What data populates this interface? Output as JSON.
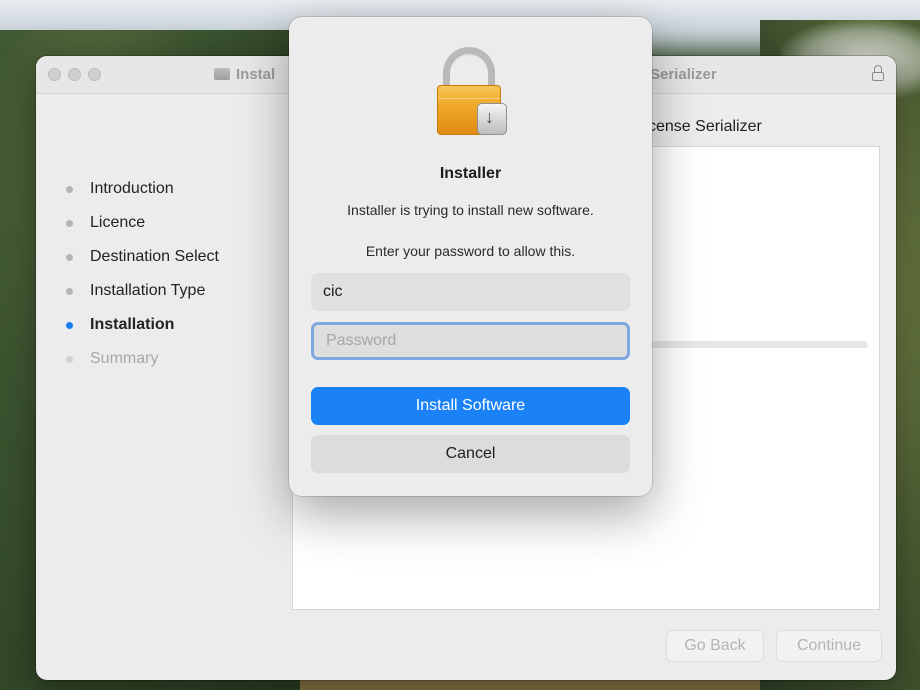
{
  "window": {
    "title_left": "Instal",
    "title_right": "Serializer",
    "subtitle": "cense Serializer"
  },
  "sidebar": {
    "items": [
      {
        "label": "Introduction",
        "state": "done"
      },
      {
        "label": "Licence",
        "state": "done"
      },
      {
        "label": "Destination Select",
        "state": "done"
      },
      {
        "label": "Installation Type",
        "state": "done"
      },
      {
        "label": "Installation",
        "state": "active"
      },
      {
        "label": "Summary",
        "state": "pending"
      }
    ]
  },
  "footer": {
    "go_back_label": "Go Back",
    "continue_label": "Continue"
  },
  "auth_dialog": {
    "icon": "lock-installer-icon",
    "title": "Installer",
    "message": "Installer is trying to install new software.",
    "prompt": "Enter your password to allow this.",
    "username_value": "cic",
    "password_placeholder": "Password",
    "install_label": "Install Software",
    "cancel_label": "Cancel"
  },
  "colors": {
    "accent": "#1a82f6",
    "active_step_dot": "#1a7cf3",
    "lock_orange": "#f0a928"
  }
}
